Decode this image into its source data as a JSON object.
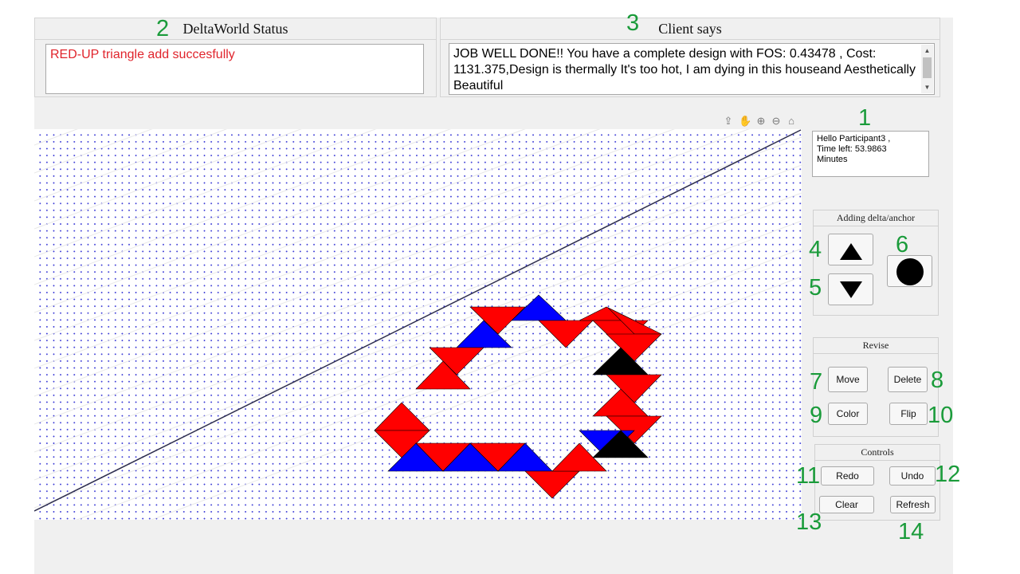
{
  "status_panel": {
    "title": "DeltaWorld Status",
    "message": "RED-UP triangle add succesfully",
    "message_color": "#e0242c"
  },
  "client_panel": {
    "title": "Client says",
    "message": "JOB WELL DONE!! You have a complete design with FOS: 0.43478 , Cost:  1131.375,Design is thermally It's too hot, I am dying in this houseand Aesthetically Beautiful"
  },
  "info": {
    "greeting": "Hello Participant3 ,",
    "time_label": "Time left:  53.9863",
    "time_unit": "Minutes"
  },
  "toolbar": {
    "icons": [
      "export-icon",
      "pan-icon",
      "zoom-in-icon",
      "zoom-out-icon",
      "home-icon"
    ]
  },
  "adding": {
    "title": "Adding delta/anchor"
  },
  "revise": {
    "title": "Revise",
    "move": "Move",
    "delete": "Delete",
    "color": "Color",
    "flip": "Flip"
  },
  "controls": {
    "title": "Controls",
    "redo": "Redo",
    "undo": "Undo",
    "clear": "Clear",
    "refresh": "Refresh"
  },
  "callouts": {
    "n1": "1",
    "n2": "2",
    "n3": "3",
    "n4": "4",
    "n5": "5",
    "n6": "6",
    "n7": "7",
    "n8": "8",
    "n9": "9",
    "n10": "10",
    "n11": "11",
    "n12": "12",
    "n13": "13",
    "n14": "14"
  },
  "colors": {
    "red": "#ff0000",
    "blue": "#0000ff",
    "black": "#000000",
    "callout_green": "#1a9b3a",
    "grid_dot": "#3b3bd6"
  }
}
